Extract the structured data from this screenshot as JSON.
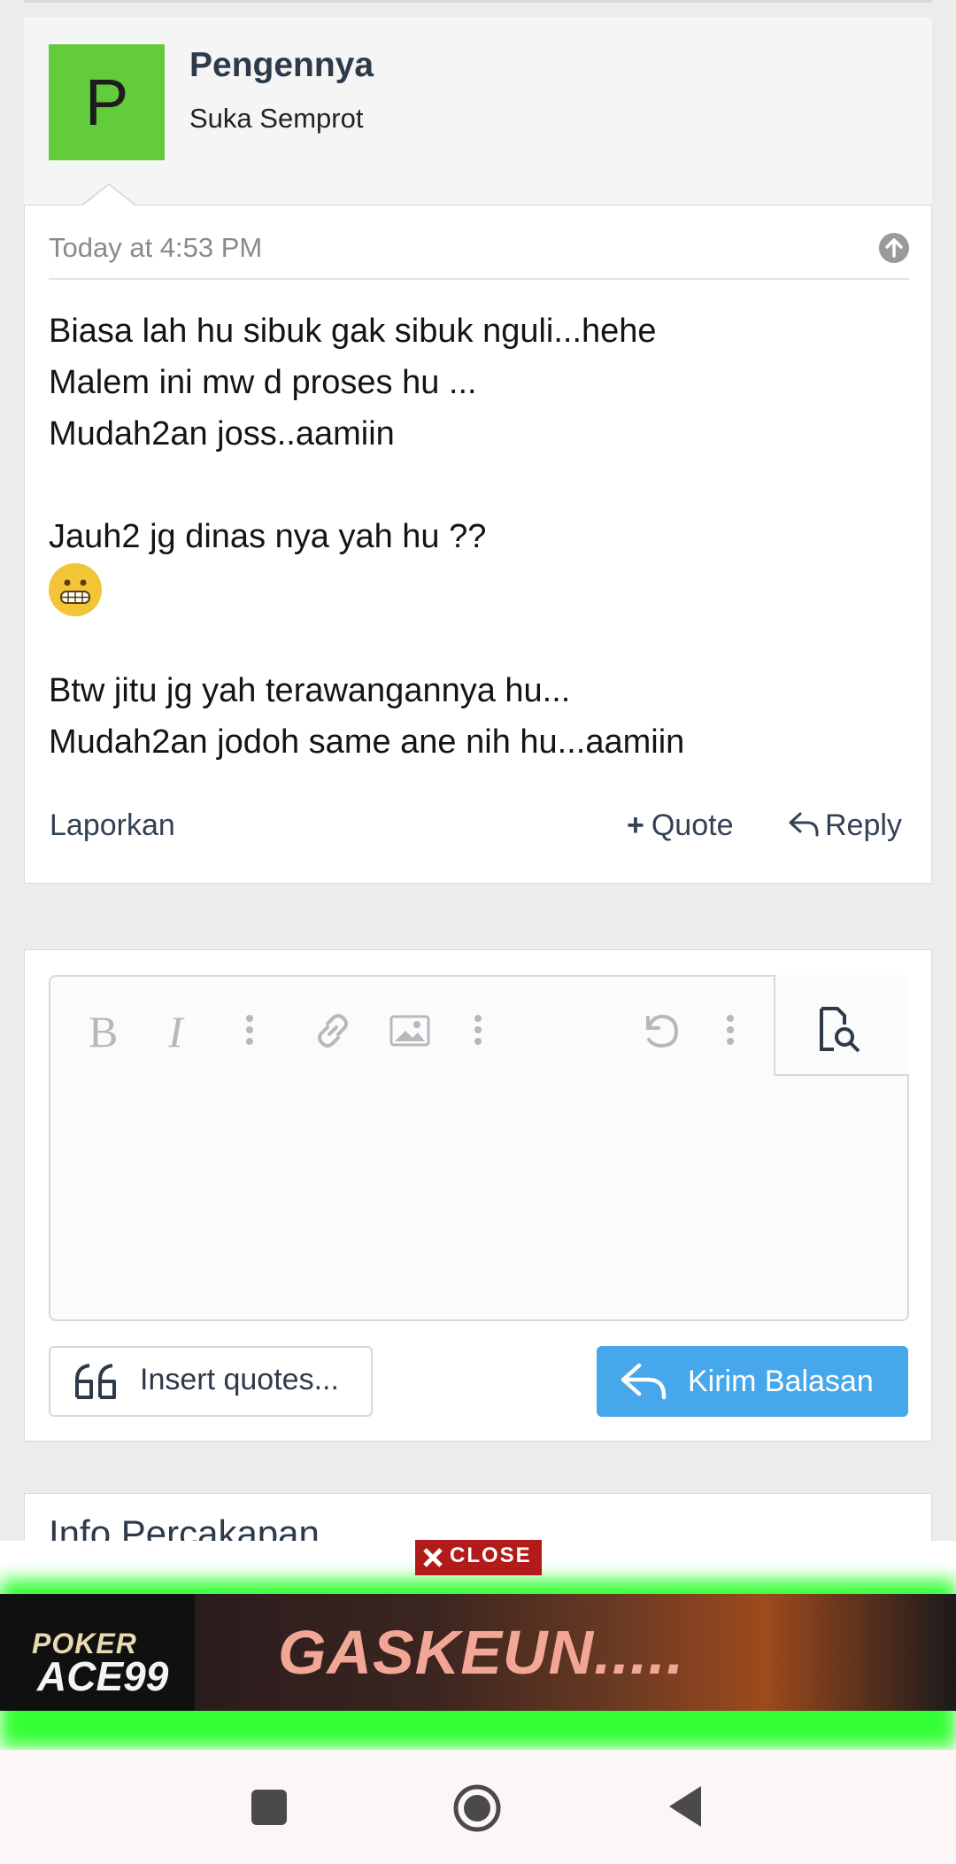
{
  "post": {
    "author": "Pengennya",
    "user_title": "Suka Semprot",
    "avatar_letter": "P",
    "timestamp": "Today at 4:53 PM",
    "body_lines": [
      "Biasa lah hu sibuk gak sibuk nguli...hehe",
      "Malem ini mw d proses hu ...",
      "Mudah2an joss..aamiin",
      "",
      "Jauh2 jg dinas nya yah hu ??",
      "",
      "",
      "Btw jitu jg yah terawangannya hu...",
      "Mudah2an jodoh same ane nih hu...aamiin"
    ],
    "emoji": "grimacing-face",
    "actions": {
      "report": "Laporkan",
      "quote": "Quote",
      "reply": "Reply"
    }
  },
  "editor": {
    "toolbar": [
      "bold",
      "italic",
      "more-options",
      "link",
      "image",
      "more-options",
      "undo",
      "more-options",
      "preview"
    ],
    "insert_quotes_label": "Insert quotes...",
    "submit_label": "Kirim Balasan"
  },
  "info": {
    "title": "Info Percakapan"
  },
  "ad": {
    "close_label": "CLOSE",
    "logo_top": "POKER",
    "logo_bottom": "ACE99",
    "headline": "GASKEUN....."
  },
  "colors": {
    "avatar": "#62cc3d",
    "accent": "#47a7eb",
    "ad_glow": "#34ff34",
    "close": "#b31b1b"
  }
}
